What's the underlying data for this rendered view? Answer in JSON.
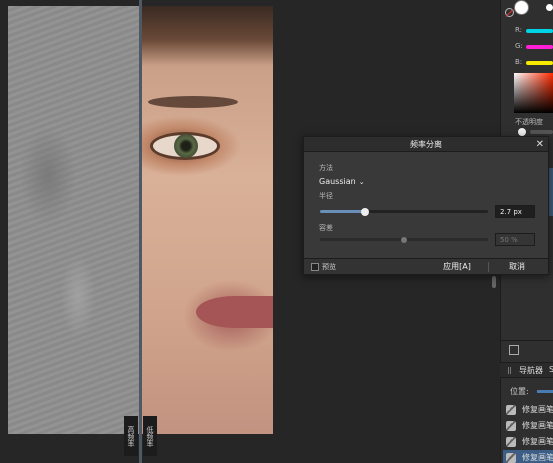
{
  "dialog": {
    "title": "频率分离",
    "method_label": "方法",
    "method_value": "Gaussian",
    "radius_label": "半径",
    "radius_value": "2.7 px",
    "radius_fraction": 0.27,
    "tolerance_label": "容差",
    "tolerance_value": "50 %",
    "tolerance_fraction": 0.5,
    "preview_label": "预览",
    "apply_button": "应用[A]",
    "cancel_button": "取消"
  },
  "canvas": {
    "left_tag": "高频率",
    "right_tag": "低频率"
  },
  "color_panel": {
    "r_label": "R:",
    "g_label": "G:",
    "b_label": "B:",
    "r_color": "#00d5e8",
    "g_color": "#ff1fd6",
    "b_color": "#f5ea00",
    "opacity_label": "不透明度"
  },
  "bottom_panel": {
    "tab_navigator": "导航器",
    "tab_s": "S",
    "position_label": "位置:"
  },
  "history": [
    {
      "label": "修复画笔"
    },
    {
      "label": "修复画笔"
    },
    {
      "label": "修复画笔"
    },
    {
      "label": "修复画笔"
    }
  ],
  "accent_color": "#3b5d86"
}
